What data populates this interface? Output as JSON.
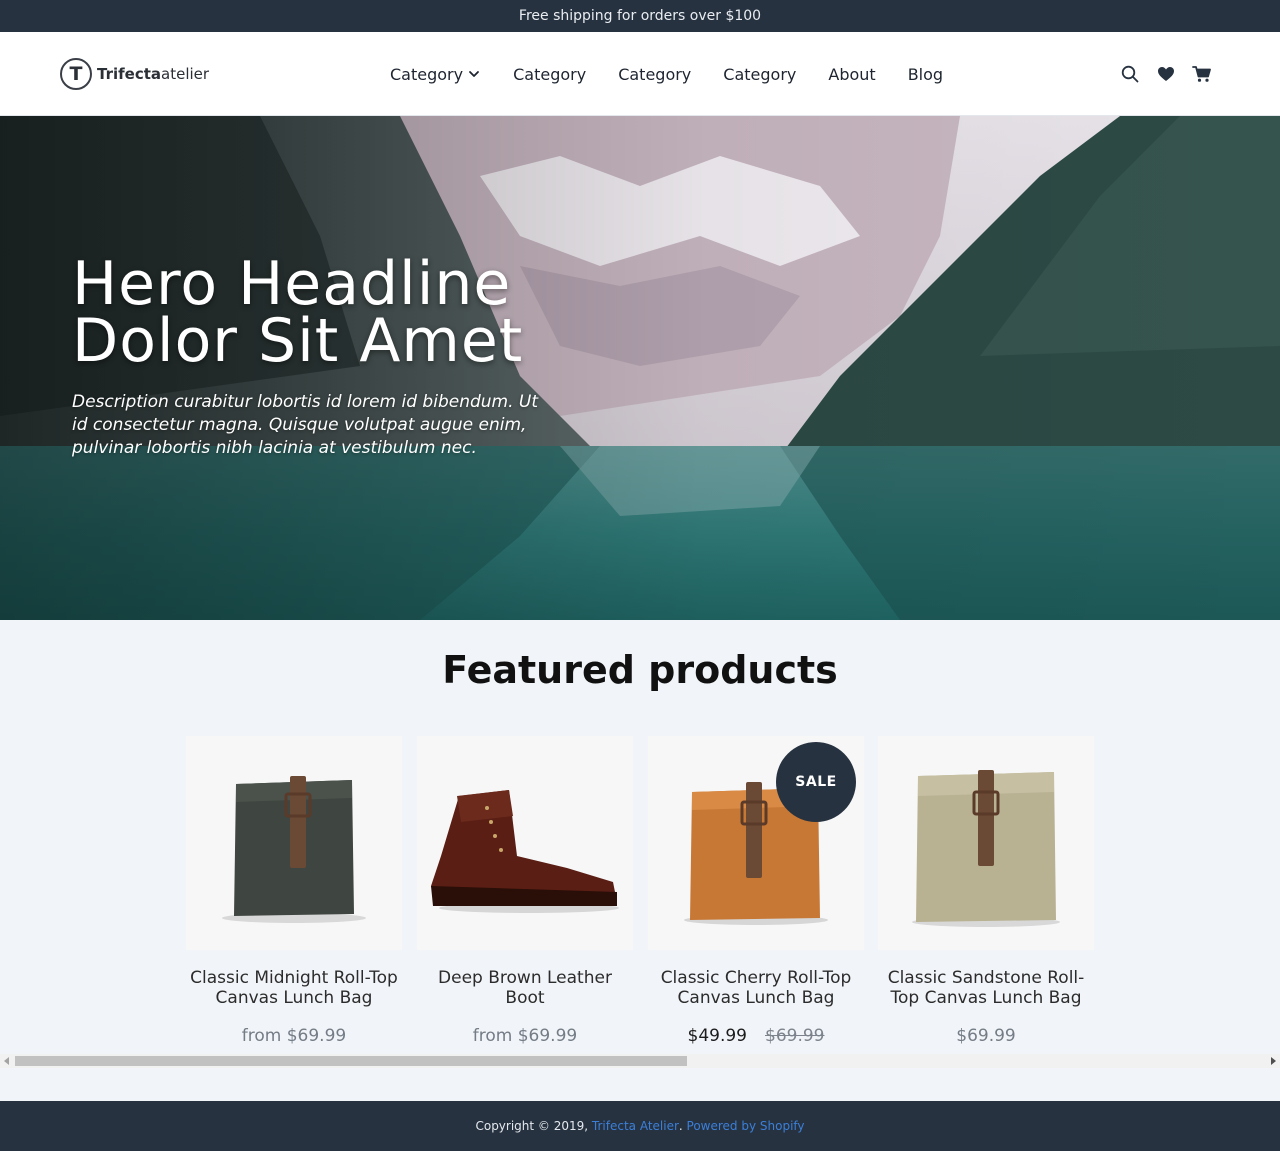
{
  "announcement": {
    "text": "Free shipping for orders over $100"
  },
  "header": {
    "logo": {
      "bold": "Trifecta",
      "regular": "atelier",
      "mark": "T"
    },
    "nav": [
      {
        "label": "Category",
        "has_dropdown": true
      },
      {
        "label": "Category"
      },
      {
        "label": "Category"
      },
      {
        "label": "Category"
      },
      {
        "label": "About"
      },
      {
        "label": "Blog"
      }
    ],
    "icons": [
      "search-icon",
      "heart-icon",
      "cart-icon"
    ]
  },
  "hero": {
    "headline_line1": "Hero Headline",
    "headline_line2": "Dolor Sit Amet",
    "description": "Description curabitur lobortis id lorem id bibendum. Ut id consectetur magna. Quisque volutpat augue enim, pulvinar lobortis nibh lacinia at vestibulum nec."
  },
  "featured": {
    "title": "Featured products",
    "products": [
      {
        "title": "Classic Midnight Roll-Top Canvas Lunch Bag",
        "price": "from $69.99",
        "image": "dark-green-lunch-bag"
      },
      {
        "title": "Deep Brown Leather Boot",
        "price": "from $69.99",
        "image": "brown-leather-boot"
      },
      {
        "title": "Classic Cherry Roll-Top Canvas Lunch Bag",
        "sale_price": "$49.99",
        "original_price": "$69.99",
        "badge": "SALE",
        "image": "orange-lunch-bag"
      },
      {
        "title": "Classic Sandstone Roll-Top Canvas Lunch Bag",
        "price": "$69.99",
        "image": "sandstone-lunch-bag"
      }
    ]
  },
  "scrollbar": {
    "position": 0.0,
    "visible_fraction": 0.53
  },
  "footer": {
    "prefix": "Copyright © 2019, ",
    "store_link": "Trifecta Atelier",
    "separator": ". ",
    "powered_link": "Powered by Shopify"
  },
  "colors": {
    "dark": "#273240",
    "link": "#3b7fd8",
    "page_bg": "#f1f4f8"
  }
}
